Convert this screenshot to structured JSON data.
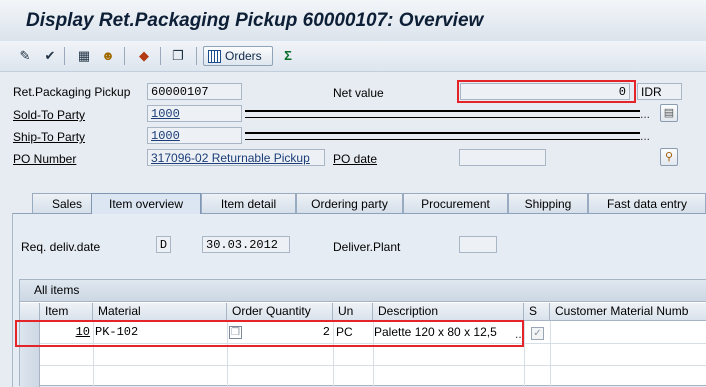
{
  "window": {
    "title": "Display Ret.Packaging Pickup 60000107: Overview"
  },
  "toolbar": {
    "icons": [
      "display-change-icon",
      "check-icon",
      "document-icon",
      "partner-icon",
      "header-icon",
      "copy-icon",
      "sum-icon"
    ],
    "orders_label": "Orders"
  },
  "header": {
    "ret_packaging_label": "Ret.Packaging Pickup",
    "ret_packaging_value": "60000107",
    "net_value_label": "Net value",
    "net_value": "0",
    "currency": "IDR",
    "sold_to_label": "Sold-To Party",
    "sold_to_value": "1000",
    "ship_to_label": "Ship-To Party",
    "ship_to_value": "1000",
    "ellipsis": "...",
    "po_number_label": "PO Number",
    "po_number_value": "317096-02 Returnable Pickup",
    "po_date_label": "PO date",
    "po_date_value": ""
  },
  "tabs": [
    "Sales",
    "Item overview",
    "Item detail",
    "Ordering party",
    "Procurement",
    "Shipping",
    "Fast data entry"
  ],
  "active_tab": "Item overview",
  "item_overview": {
    "req_deliv_date_label": "Req. deliv.date",
    "date_type": "D",
    "req_deliv_date": "30.03.2012",
    "deliver_plant_label": "Deliver.Plant",
    "deliver_plant_value": ""
  },
  "grid": {
    "title": "All items",
    "columns": [
      "Item",
      "Material",
      "Order Quantity",
      "Un",
      "Description",
      "S",
      "Customer Material Numb"
    ],
    "rows": [
      {
        "item": "10",
        "material": "PK-102",
        "order_quantity": "2",
        "unit": "PC",
        "description": "Palette 120 x 80 x 12,5",
        "s_checked": true,
        "customer_material": ""
      }
    ]
  },
  "colors": {
    "highlight": "#e5242a",
    "link": "#1b3d78"
  }
}
